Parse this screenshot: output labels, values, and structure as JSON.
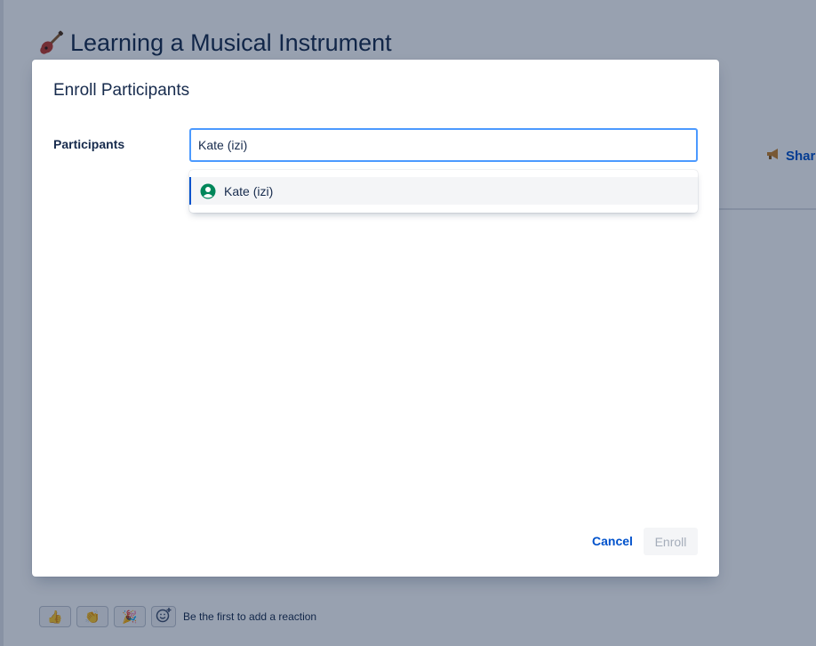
{
  "page": {
    "title": "Learning a Musical Instrument",
    "title_icon": "guitar-icon",
    "share_label": "Share",
    "reactions": {
      "buttons": [
        {
          "icon": "thumbs-up-icon",
          "glyph": "👍"
        },
        {
          "icon": "clapping-hands-icon",
          "glyph": "👏"
        },
        {
          "icon": "party-popper-icon",
          "glyph": "🎉"
        }
      ],
      "add_icon": "add-reaction-icon",
      "prompt": "Be the first to add a reaction"
    }
  },
  "modal": {
    "title": "Enroll Participants",
    "participants_label": "Participants",
    "participants_value": "Kate (izi)",
    "suggestions": [
      {
        "label": "Kate (izi)",
        "icon": "user-avatar-icon"
      }
    ],
    "cancel_label": "Cancel",
    "enroll_label": "Enroll"
  },
  "colors": {
    "accent": "#0052cc",
    "focus_border": "#4c9aff",
    "user_icon": "#00875a",
    "overlay": "rgba(9,30,66,0.42)"
  }
}
